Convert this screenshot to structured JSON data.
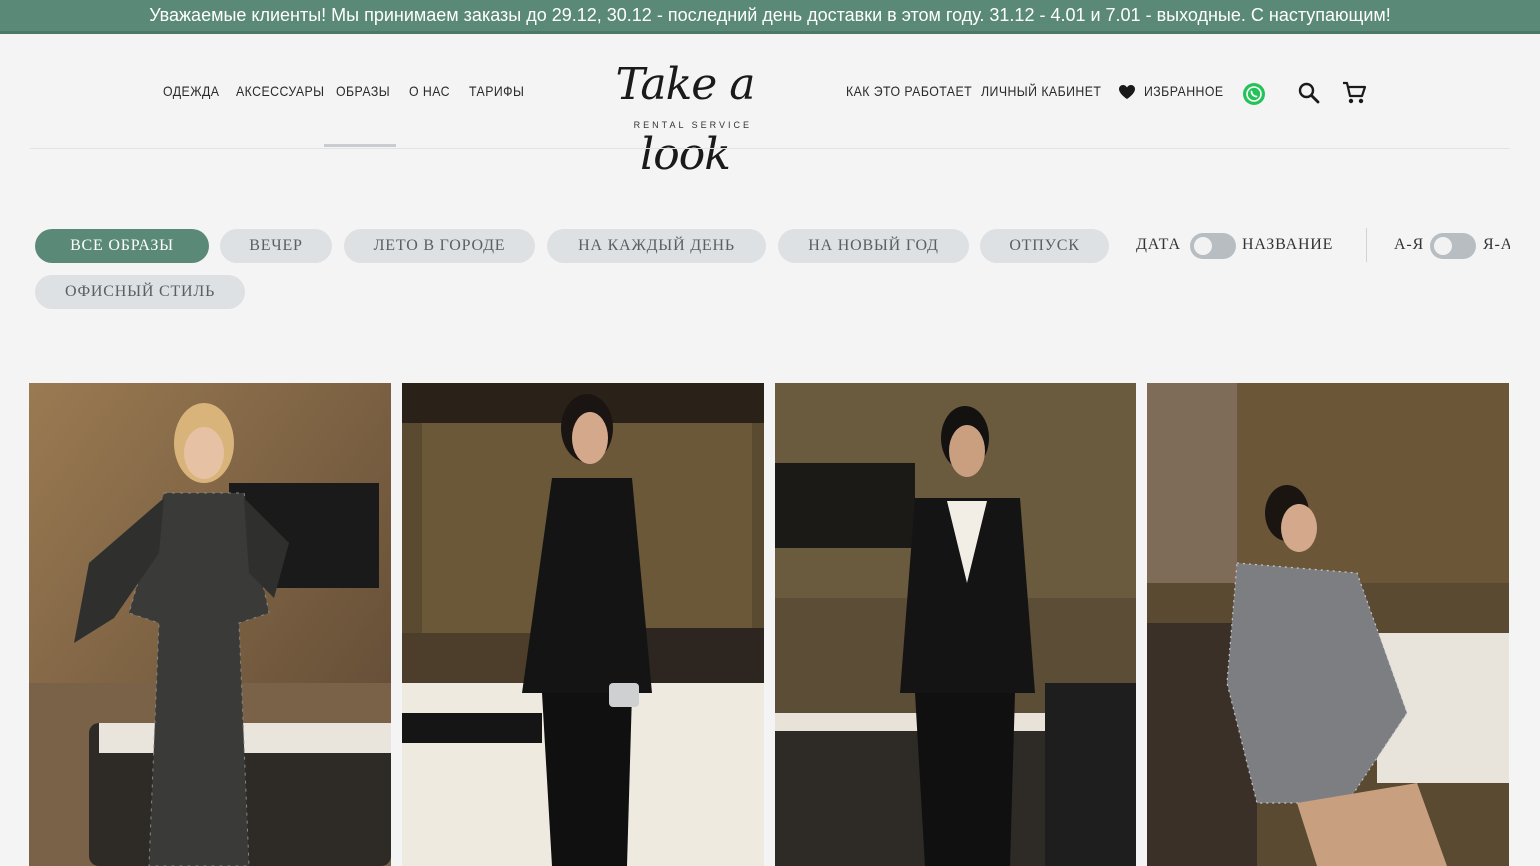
{
  "announcement": "Уважаемые клиенты! Мы принимаем заказы до 29.12, 30.12 - последний день доставки в этом году. 31.12 - 4.01 и 7.01 - выходные. С наступающим!",
  "nav_left": [
    "ОДЕЖДА",
    "АКСЕССУАРЫ",
    "ОБРАЗЫ",
    "О НАС",
    "ТАРИФЫ"
  ],
  "logo": {
    "script": "Take a look",
    "sub": "RENTAL SERVICE"
  },
  "nav_right": {
    "how": "КАК ЭТО РАБОТАЕТ",
    "account": "ЛИЧНЫЙ КАБИНЕТ",
    "favorites": "ИЗБРАННОЕ"
  },
  "icons": {
    "favorites": "heart-icon",
    "messenger": "whatsapp-icon",
    "search": "search-icon",
    "cart": "cart-icon"
  },
  "filters": [
    "ВСЕ ОБРАЗЫ",
    "ВЕЧЕР",
    "ЛЕТО В ГОРОДЕ",
    "НА КАЖДЫЙ ДЕНЬ",
    "НА НОВЫЙ ГОД",
    "ОТПУСК",
    "ОФИСНЫЙ СТИЛЬ"
  ],
  "active_filter": "ВСЕ ОБРАЗЫ",
  "sort": {
    "date": "ДАТА",
    "name": "НАЗВАНИЕ",
    "az": "А-Я",
    "za": "Я-А"
  },
  "colors": {
    "accent": "#5a8a77",
    "chip": "#dde1e3",
    "background": "#f4f4f4"
  },
  "products": [
    "look-photo-sequin-dress",
    "look-photo-black-cape-suit",
    "look-photo-tuxedo-suit",
    "look-photo-sequin-mini-dress"
  ]
}
